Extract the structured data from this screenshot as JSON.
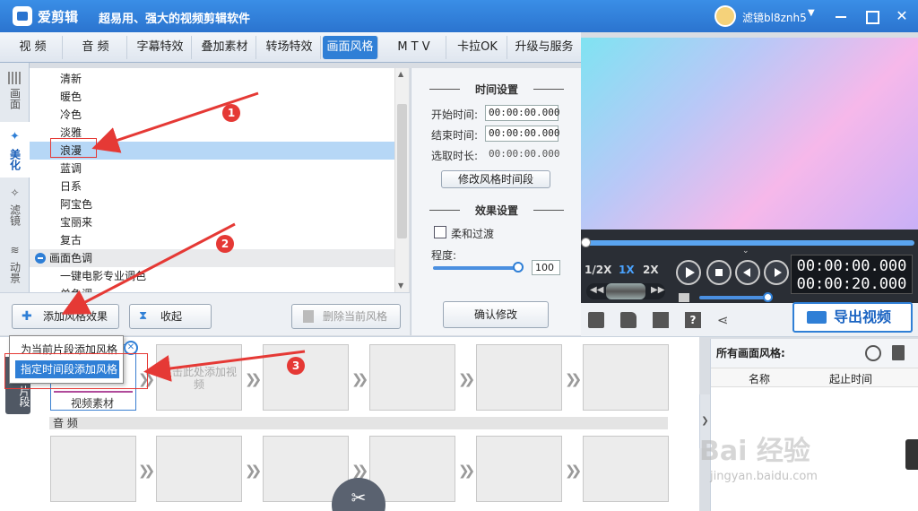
{
  "app": {
    "name": "爱剪辑",
    "slogan": "超易用、强大的视频剪辑软件",
    "username": "滤镜bl8znh5"
  },
  "tabs": [
    {
      "label": "视 频"
    },
    {
      "label": "音 频"
    },
    {
      "label": "字幕特效"
    },
    {
      "label": "叠加素材"
    },
    {
      "label": "转场特效"
    },
    {
      "label": "画面风格"
    },
    {
      "label": "M T V"
    },
    {
      "label": "卡拉OK"
    },
    {
      "label": "升级与服务"
    }
  ],
  "side_tabs": [
    {
      "label": "画面"
    },
    {
      "label": "美化"
    },
    {
      "label": "滤镜"
    },
    {
      "label": "动景"
    }
  ],
  "style_list": {
    "items": [
      "清新",
      "暖色",
      "冷色",
      "淡雅",
      "浪漫",
      "蓝调",
      "日系",
      "阿宝色",
      "宝丽来",
      "复古"
    ],
    "selected": "浪漫",
    "group": "画面色调",
    "group_items": [
      "一键电影专业调色",
      "单色调"
    ]
  },
  "left_buttons": {
    "add": "添加风格效果",
    "collapse": "收起",
    "delete": "删除当前风格"
  },
  "popup": {
    "item1": "为当前片段添加风格",
    "item2": "指定时间段添加风格"
  },
  "settings": {
    "time_title": "时间设置",
    "start_label": "开始时间:",
    "start_value": "00:00:00.000",
    "end_label": "结束时间:",
    "end_value": "00:00:00.000",
    "duration_label": "选取时长:",
    "duration_value": "00:00:00.000",
    "modify_range": "修改风格时间段",
    "effect_title": "效果设置",
    "soft_transition": "柔和过渡",
    "degree_label": "程度:",
    "degree_value": "100",
    "degree_level": 1.0,
    "confirm": "确认修改"
  },
  "player": {
    "speeds": [
      "1/2X",
      "1X",
      "2X"
    ],
    "active_speed": "1X",
    "time_current": "00:00:00.000",
    "time_total": "00:00:20.000",
    "progress": 0.0,
    "volume": 0.9
  },
  "export_label": "导出视频",
  "timeline": {
    "side_label": "片段",
    "slot_hint": "双击此处添加视频",
    "video_clip_label": "视频素材",
    "audio_label": "音 频"
  },
  "right_panel": {
    "title": "所有画面风格:",
    "col_name": "名称",
    "col_time": "起止时间"
  },
  "annotations": [
    "1",
    "2",
    "3"
  ],
  "watermark": {
    "brand": "Bai 经验",
    "url": "jingyan.baidu.com"
  },
  "colors": {
    "accent": "#2f7fd6",
    "annotation": "#e53935"
  }
}
